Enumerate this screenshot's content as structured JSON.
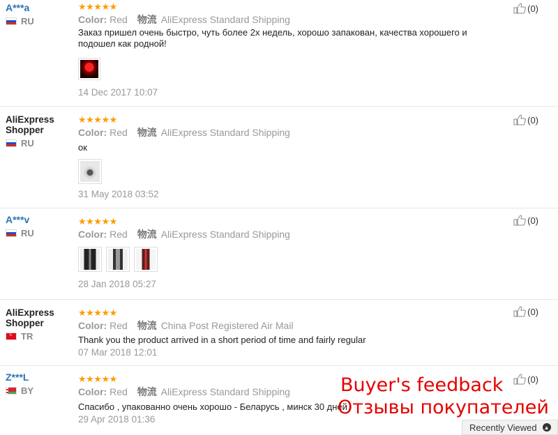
{
  "reviews": [
    {
      "user": "A***a",
      "country": "RU",
      "stars": "★★★★★",
      "color_label": "Color:",
      "color_value": "Red",
      "logistics_label": "物流",
      "shipping": "AliExpress Standard Shipping",
      "feedback": "Заказ пришел очень быстро, чуть более 2х недель, хорошо запакован, качества хорошего и подошел как родной!",
      "date": "14 Dec 2017 10:07",
      "helpful": "(0)"
    },
    {
      "user": "AliExpress Shopper",
      "country": "RU",
      "stars": "★★★★★",
      "color_label": "Color:",
      "color_value": "Red",
      "logistics_label": "物流",
      "shipping": "AliExpress Standard Shipping",
      "feedback": "ок",
      "date": "31 May 2018 03:52",
      "helpful": "(0)"
    },
    {
      "user": "A***v",
      "country": "RU",
      "stars": "★★★★★",
      "color_label": "Color:",
      "color_value": "Red",
      "logistics_label": "物流",
      "shipping": "AliExpress Standard Shipping",
      "feedback": "",
      "date": "28 Jan 2018 05:27",
      "helpful": "(0)"
    },
    {
      "user": "AliExpress Shopper",
      "country": "TR",
      "stars": "★★★★★",
      "color_label": "Color:",
      "color_value": "Red",
      "logistics_label": "物流",
      "shipping": "China Post Registered Air Mail",
      "feedback": "Thank you the product arrived in a short period of time and fairly regular",
      "date": "07 Mar 2018 12:01",
      "helpful": "(0)"
    },
    {
      "user": "Z***L",
      "country": "BY",
      "stars": "★★★★★",
      "color_label": "Color:",
      "color_value": "Red",
      "logistics_label": "物流",
      "shipping": "AliExpress Standard Shipping",
      "feedback": "Спасибо , упакованно очень хорошо - Беларусь , минск 30 дней",
      "date": "29 Apr 2018 01:36",
      "helpful": "(0)"
    }
  ],
  "overlay": {
    "line1": "Buyer's feedback",
    "line2": "Отзывы покупателей"
  },
  "recently_viewed": "Recently Viewed",
  "colors": {
    "star": "#ff9b00",
    "masked_user": "#2a73b8",
    "overlay": "#e60000"
  }
}
